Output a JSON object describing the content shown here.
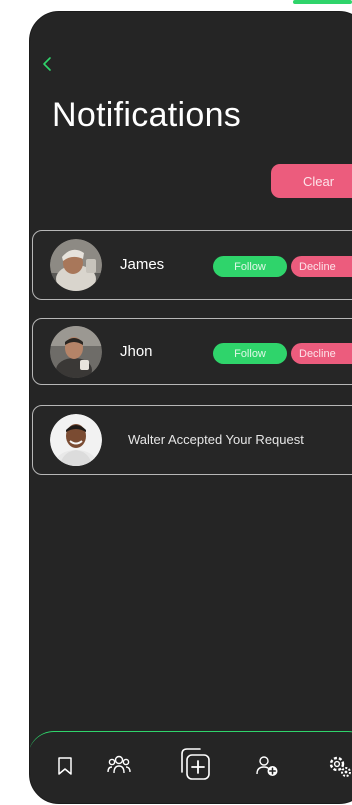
{
  "header": {
    "title": "Notifications",
    "clear_label": "Clear"
  },
  "colors": {
    "background": "#252525",
    "accent_green": "#2fd46b",
    "accent_pink": "#ec5c7d",
    "card_border": "#b7b7b7"
  },
  "notifications": [
    {
      "name": "James",
      "follow_label": "Follow",
      "decline_label": "Decline",
      "avatar": "person-with-beanie"
    },
    {
      "name": "Jhon",
      "follow_label": "Follow",
      "decline_label": "Decline",
      "avatar": "person-holding-cup"
    },
    {
      "message": "Walter Accepted Your Request",
      "avatar": "smiling-man"
    }
  ],
  "bottom_nav": {
    "icons": [
      "bookmark-icon",
      "group-icon",
      "add-post-icon",
      "add-user-icon",
      "settings-icon"
    ]
  }
}
